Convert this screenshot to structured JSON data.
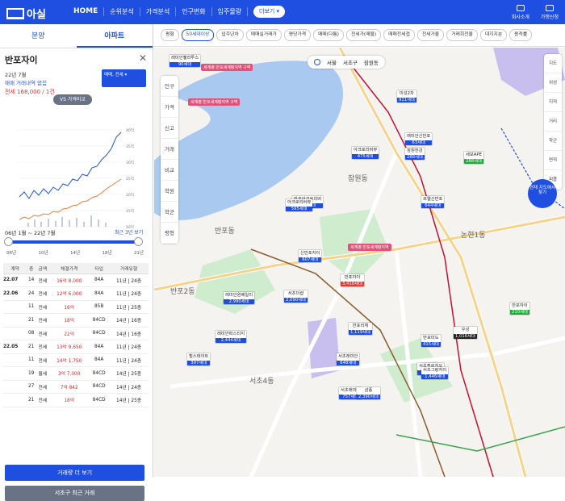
{
  "header": {
    "logo": "아실",
    "nav": [
      "HOME",
      "순위분석",
      "가격분석",
      "인구변화",
      "입주물량",
      "분양"
    ],
    "more": "더보기",
    "links": [
      "회사소개",
      "가맹신청"
    ]
  },
  "left": {
    "tabs": [
      "분양",
      "아파트"
    ],
    "apt_name": "반포자이",
    "info1": "22년 7월",
    "info2": "매매 거래내역 없음",
    "info3": "전세 168,000 / 1건",
    "vs_button": "VS 가격비교",
    "select_label": "매매, 전세",
    "range_text": "06년 1월 ~ 22년 7월",
    "range_recent": "최근 3년 보기",
    "slider_ticks": [
      "06년",
      "10년",
      "14년",
      "18년",
      "21년"
    ],
    "table_headers": [
      "계약",
      "층",
      "금액",
      "체결가격",
      "타입",
      "거래유형"
    ],
    "table_rows": [
      [
        "22.07",
        "14",
        "전세",
        "16억 8,000",
        "84A",
        "11년 | 24층"
      ],
      [
        "22.06",
        "24",
        "전세",
        "12억 6,000",
        "84A",
        "11년 | 24층"
      ],
      [
        "",
        "11",
        "전세",
        "16억",
        "85B",
        "11년 | 25층"
      ],
      [
        "",
        "21",
        "전세",
        "18억",
        "84CD",
        "14년 | 16층"
      ],
      [
        "",
        "08",
        "전세",
        "22억",
        "84CD",
        "14년 | 16층"
      ],
      [
        "22.05",
        "21",
        "전세",
        "13억 9,650",
        "84A",
        "11년 | 24층"
      ],
      [
        "",
        "11",
        "전세",
        "14억 1,750",
        "84A",
        "11년 | 24층"
      ],
      [
        "",
        "19",
        "월세",
        "3억 7,000",
        "84CD",
        "14년 | 25층"
      ],
      [
        "",
        "27",
        "전세",
        "7억 842",
        "84CD",
        "14년 | 24층"
      ],
      [
        "",
        "21",
        "전세",
        "18억",
        "84CD",
        "14년 | 25층"
      ]
    ],
    "btn_primary": "거래량 더 보기",
    "btn_secondary": "서초구 최근 거래"
  },
  "filters": [
    "평형",
    "50세대이상",
    "입주년차",
    "매매실거래가",
    "평당가격",
    "매매(다툼)",
    "전세가(매물)",
    "매매전세갭",
    "전세가율",
    "거래회전율",
    "대지지분",
    "용적률"
  ],
  "map": {
    "location": [
      "서울",
      "서초구",
      "잠원동"
    ],
    "left_legend": [
      "인구",
      "가격",
      "신고",
      "거래",
      "비교",
      "학원",
      "학군",
      "평형"
    ],
    "right_tools": [
      "지도",
      "위성",
      "지적",
      "거리",
      "학군",
      "면적",
      "피플"
    ],
    "search_btn": "현재 지도에서 찾기",
    "districts": [
      "반포동",
      "반포2동",
      "반포3동",
      "서초4동",
      "잠원동",
      "논현1동"
    ],
    "zones": [
      "세계평 반포세계평지역 구역",
      "세계평 반포세계평지역 구역",
      "세계평 반포세계평지역"
    ],
    "markers": [
      {
        "n": "래미안첼리투스",
        "c": "90세대",
        "k": "b"
      },
      {
        "n": "반포자이",
        "c": "3,410세대",
        "k": "r"
      },
      {
        "n": "반포리체",
        "c": "1,119세대",
        "k": "b"
      },
      {
        "n": "반포아크로리버",
        "c": "585세대",
        "k": "b"
      },
      {
        "n": "신반포자이",
        "c": "607세대",
        "k": "b"
      },
      {
        "n": "아크로리버뷰",
        "c": "595세대",
        "k": "b"
      },
      {
        "n": "래미안원베일리",
        "c": "2,990세대",
        "k": "b"
      },
      {
        "n": "래미안퍼스티지",
        "c": "2,444세대",
        "k": "b"
      },
      {
        "n": "힐스테이트",
        "c": "397세대",
        "k": "b"
      },
      {
        "n": "미성2차",
        "c": "911세대",
        "k": "b"
      },
      {
        "n": "래미안신반포",
        "c": "63세대",
        "k": "b"
      },
      {
        "n": "잠원한강",
        "c": "288세대",
        "k": "b"
      },
      {
        "n": "아크로리버뷰",
        "c": "475세대",
        "k": "b"
      },
      {
        "n": "세보APE",
        "c": "288세대",
        "k": "g"
      },
      {
        "n": "르엘신반포",
        "c": "644세대",
        "k": "b"
      },
      {
        "n": "서초래미안",
        "c": "757세대",
        "k": "b"
      },
      {
        "n": "서초더샵",
        "c": "2,090세대",
        "k": "b"
      },
      {
        "n": "반포미도",
        "c": "415세대",
        "k": "b"
      },
      {
        "n": "서초푸르지오",
        "c": "907세대",
        "k": "b"
      },
      {
        "n": "우성",
        "c": "1,016세대",
        "k": "d"
      },
      {
        "n": "서초그랑자이",
        "c": "1,446세대",
        "k": "b"
      },
      {
        "n": "삼풍",
        "c": "2,390세대",
        "k": "b"
      },
      {
        "n": "서초래미안",
        "c": "648세대",
        "k": "b"
      },
      {
        "n": "반포자이",
        "c": "210세대",
        "k": "g"
      }
    ]
  },
  "colors": {
    "brand": "#1f4fe0",
    "red": "#e33",
    "green": "#1eaa3a"
  },
  "chart_data": {
    "type": "line",
    "series": [
      {
        "name": "매매",
        "color": "#1f4fe0"
      },
      {
        "name": "전세",
        "color": "#f07a3a"
      }
    ],
    "x_ticks": [
      "06년",
      "10년",
      "14년",
      "18년",
      "21년"
    ],
    "y_right_ticks": [
      "40억",
      "35억",
      "30억",
      "25억",
      "20억",
      "15억",
      "10억",
      "5억"
    ]
  }
}
